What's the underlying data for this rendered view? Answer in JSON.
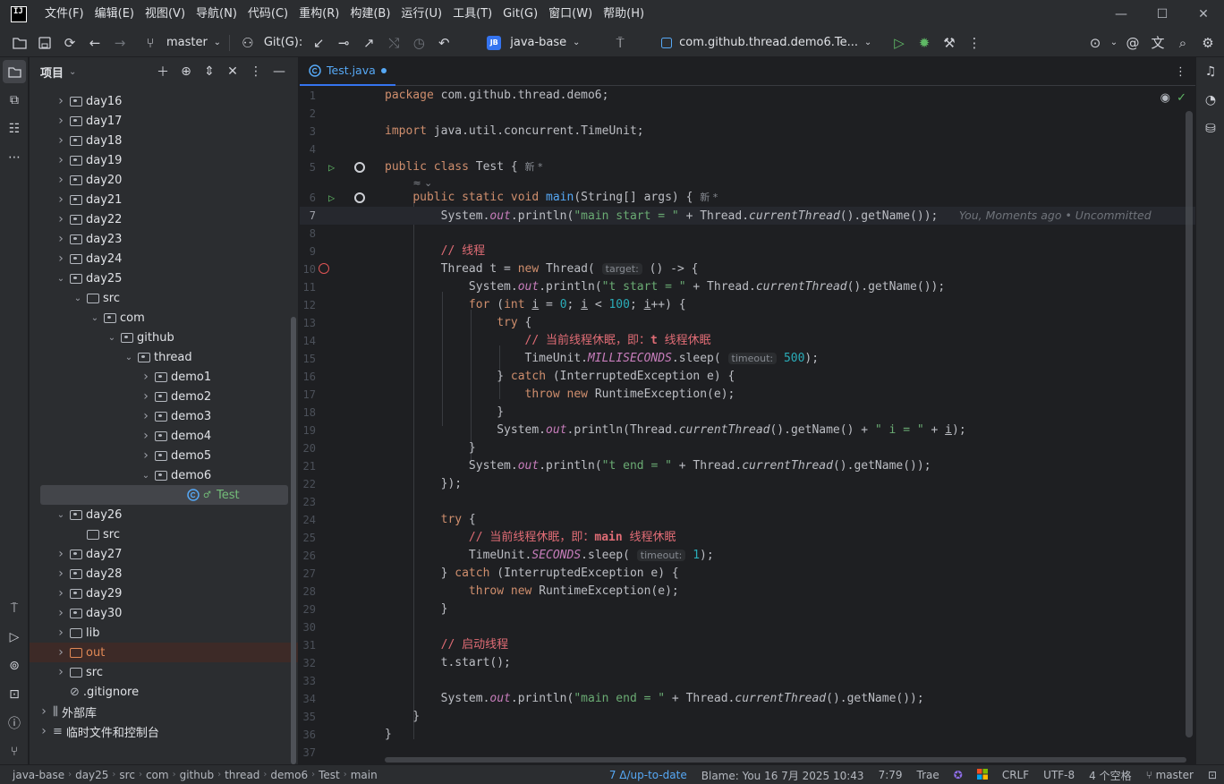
{
  "titlebar": {
    "logo": "IJ",
    "menus": [
      "文件(F)",
      "编辑(E)",
      "视图(V)",
      "导航(N)",
      "代码(C)",
      "重构(R)",
      "构建(B)",
      "运行(U)",
      "工具(T)",
      "Git(G)",
      "窗口(W)",
      "帮助(H)"
    ]
  },
  "toolbar": {
    "branch": "master",
    "git_label": "Git(G):",
    "project_badge": "JB",
    "project_name": "java-base",
    "run_config": "com.github.thread.demo6.Te..."
  },
  "project_panel": {
    "title": "项目",
    "tree": [
      {
        "label": "day16",
        "depth": 1,
        "expanded": false,
        "icon": "module"
      },
      {
        "label": "day17",
        "depth": 1,
        "expanded": false,
        "icon": "module"
      },
      {
        "label": "day18",
        "depth": 1,
        "expanded": false,
        "icon": "module"
      },
      {
        "label": "day19",
        "depth": 1,
        "expanded": false,
        "icon": "module"
      },
      {
        "label": "day20",
        "depth": 1,
        "expanded": false,
        "icon": "module"
      },
      {
        "label": "day21",
        "depth": 1,
        "expanded": false,
        "icon": "module"
      },
      {
        "label": "day22",
        "depth": 1,
        "expanded": false,
        "icon": "module"
      },
      {
        "label": "day23",
        "depth": 1,
        "expanded": false,
        "icon": "module"
      },
      {
        "label": "day24",
        "depth": 1,
        "expanded": false,
        "icon": "module"
      },
      {
        "label": "day25",
        "depth": 1,
        "expanded": true,
        "icon": "module"
      },
      {
        "label": "src",
        "depth": 2,
        "expanded": true,
        "icon": "folder"
      },
      {
        "label": "com",
        "depth": 3,
        "expanded": true,
        "icon": "package"
      },
      {
        "label": "github",
        "depth": 4,
        "expanded": true,
        "icon": "package"
      },
      {
        "label": "thread",
        "depth": 5,
        "expanded": true,
        "icon": "package"
      },
      {
        "label": "demo1",
        "depth": 6,
        "expanded": false,
        "icon": "package"
      },
      {
        "label": "demo2",
        "depth": 6,
        "expanded": false,
        "icon": "package"
      },
      {
        "label": "demo3",
        "depth": 6,
        "expanded": false,
        "icon": "package"
      },
      {
        "label": "demo4",
        "depth": 6,
        "expanded": false,
        "icon": "package"
      },
      {
        "label": "demo5",
        "depth": 6,
        "expanded": false,
        "icon": "package"
      },
      {
        "label": "demo6",
        "depth": 6,
        "expanded": true,
        "icon": "package"
      },
      {
        "label": "Test",
        "depth": 8,
        "expanded": null,
        "icon": "class",
        "selected": true
      },
      {
        "label": "day26",
        "depth": 1,
        "expanded": true,
        "icon": "module"
      },
      {
        "label": "src",
        "depth": 2,
        "expanded": null,
        "icon": "folder"
      },
      {
        "label": "day27",
        "depth": 1,
        "expanded": false,
        "icon": "module"
      },
      {
        "label": "day28",
        "depth": 1,
        "expanded": false,
        "icon": "module"
      },
      {
        "label": "day29",
        "depth": 1,
        "expanded": false,
        "icon": "module"
      },
      {
        "label": "day30",
        "depth": 1,
        "expanded": false,
        "icon": "module"
      },
      {
        "label": "lib",
        "depth": 1,
        "expanded": false,
        "icon": "folder"
      },
      {
        "label": "out",
        "depth": 1,
        "expanded": false,
        "icon": "excluded"
      },
      {
        "label": "src",
        "depth": 1,
        "expanded": false,
        "icon": "folder"
      },
      {
        "label": ".gitignore",
        "depth": 1,
        "expanded": null,
        "icon": "ignore"
      },
      {
        "label": "外部库",
        "depth": 0,
        "expanded": false,
        "icon": "library"
      },
      {
        "label": "临时文件和控制台",
        "depth": 0,
        "expanded": false,
        "icon": "scratch"
      }
    ]
  },
  "editor": {
    "tab_label": "Test.java",
    "lines": [
      {
        "n": "1",
        "html": "<span class=\"kw\">package</span> com.github.thread.demo6;"
      },
      {
        "n": "2",
        "html": ""
      },
      {
        "n": "3",
        "html": "<span class=\"kw\">import</span> java.util.concurrent.TimeUnit;"
      },
      {
        "n": "4",
        "html": ""
      },
      {
        "n": "5",
        "html": "<span class=\"kw\">public class</span> Test { <span class=\"badge-new\">新 *</span>"
      },
      {
        "n": "",
        "html": "    <span class=\"badge-new\">≈ ⌄</span>"
      },
      {
        "n": "6",
        "html": "    <span class=\"kw\">public static void</span> <span class=\"fn\">main</span>(String[] args) { <span class=\"badge-new\">新 *</span>"
      },
      {
        "n": "7",
        "html": "        System.<span class=\"fld ital\">out</span>.println(<span class=\"str\">\"main start = \"</span> + Thread.<span class=\"ital\">currentThread</span>().getName());   <span class=\"blame\">You, Moments ago • Uncommitted</span>"
      },
      {
        "n": "8",
        "html": ""
      },
      {
        "n": "9",
        "html": "        <span class=\"cmt-cn\">// 线程</span>"
      },
      {
        "n": "10",
        "html": "        Thread t = <span class=\"kw\">new</span> Thread( <span class=\"hint\">target:</span> () -> {"
      },
      {
        "n": "11",
        "html": "            System.<span class=\"fld ital\">out</span>.println(<span class=\"str\">\"t start = \"</span> + Thread.<span class=\"ital\">currentThread</span>().getName());"
      },
      {
        "n": "12",
        "html": "            <span class=\"kw\">for</span> (<span class=\"kw\">int</span> <u>i</u> = <span class=\"num\">0</span>; <u>i</u> &lt; <span class=\"num\">100</span>; <u>i</u>++) {"
      },
      {
        "n": "13",
        "html": "                <span class=\"kw\">try</span> {"
      },
      {
        "n": "14",
        "html": "                    <span class=\"cmt-cn\">// 当前线程休眠，即：<b>t</b> 线程休眠</span>"
      },
      {
        "n": "15",
        "html": "                    TimeUnit.<span class=\"fld ital\">MILLISECONDS</span>.sleep( <span class=\"hint\">timeout:</span> <span class=\"num\">500</span>);"
      },
      {
        "n": "16",
        "html": "                } <span class=\"kw\">catch</span> (InterruptedException e) {"
      },
      {
        "n": "17",
        "html": "                    <span class=\"kw\">throw new</span> RuntimeException(e);"
      },
      {
        "n": "18",
        "html": "                }"
      },
      {
        "n": "19",
        "html": "                System.<span class=\"fld ital\">out</span>.println(Thread.<span class=\"ital\">currentThread</span>().getName() + <span class=\"str\">\" i = \"</span> + <u>i</u>);"
      },
      {
        "n": "20",
        "html": "            }"
      },
      {
        "n": "21",
        "html": "            System.<span class=\"fld ital\">out</span>.println(<span class=\"str\">\"t end = \"</span> + Thread.<span class=\"ital\">currentThread</span>().getName());"
      },
      {
        "n": "22",
        "html": "        });"
      },
      {
        "n": "23",
        "html": ""
      },
      {
        "n": "24",
        "html": "        <span class=\"kw\">try</span> {"
      },
      {
        "n": "25",
        "html": "            <span class=\"cmt-cn\">// 当前线程休眠，即：<b>main</b> 线程休眠</span>"
      },
      {
        "n": "26",
        "html": "            TimeUnit.<span class=\"fld ital\">SECONDS</span>.sleep( <span class=\"hint\">timeout:</span> <span class=\"num\">1</span>);"
      },
      {
        "n": "27",
        "html": "        } <span class=\"kw\">catch</span> (InterruptedException e) {"
      },
      {
        "n": "28",
        "html": "            <span class=\"kw\">throw new</span> RuntimeException(e);"
      },
      {
        "n": "29",
        "html": "        }"
      },
      {
        "n": "30",
        "html": ""
      },
      {
        "n": "31",
        "html": "        <span class=\"cmt-cn\">// 启动线程</span>"
      },
      {
        "n": "32",
        "html": "        t.start();"
      },
      {
        "n": "33",
        "html": ""
      },
      {
        "n": "34",
        "html": "        System.<span class=\"fld ital\">out</span>.println(<span class=\"str\">\"main end = \"</span> + Thread.<span class=\"ital\">currentThread</span>().getName());"
      },
      {
        "n": "35",
        "html": "    }"
      },
      {
        "n": "36",
        "html": "}"
      },
      {
        "n": "37",
        "html": ""
      }
    ]
  },
  "statusbar": {
    "breadcrumbs": [
      "java-base",
      "day25",
      "src",
      "com",
      "github",
      "thread",
      "demo6",
      "Test",
      "main"
    ],
    "vcs_status": "7 Δ/up-to-date",
    "blame": "Blame: You 16 7月 2025 10:43",
    "position": "7:79",
    "trae": "Trae",
    "line_separator": "CRLF",
    "encoding": "UTF-8",
    "indent": "4 个空格",
    "branch": "master"
  },
  "colors": {
    "accent": "#3574f0",
    "keyword": "#cf8e6d",
    "string": "#6aab73",
    "run": "#5fb865"
  }
}
